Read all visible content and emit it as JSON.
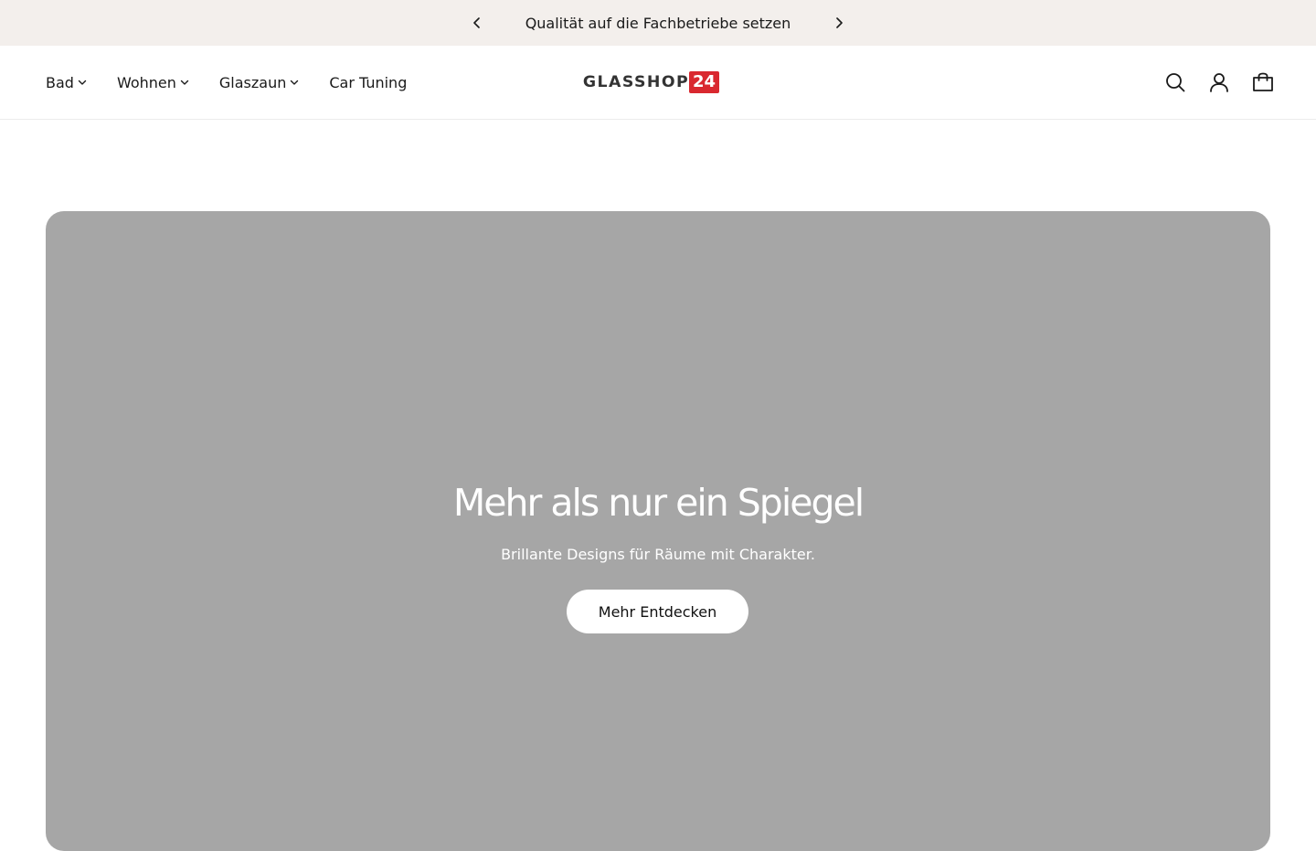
{
  "announcement": {
    "text": "Qualität auf die Fachbetriebe setzen",
    "prev_icon": "chevron-left-icon",
    "next_icon": "chevron-right-icon"
  },
  "header": {
    "nav": [
      {
        "label": "Bad",
        "has_dropdown": true
      },
      {
        "label": "Wohnen",
        "has_dropdown": true
      },
      {
        "label": "Glaszaun",
        "has_dropdown": true
      },
      {
        "label": "Car Tuning",
        "has_dropdown": false
      }
    ],
    "logo": {
      "text": "GLASSHOP",
      "badge": "24",
      "badge_color": "#d9282f"
    },
    "icons": [
      "search-icon",
      "account-icon",
      "cart-icon"
    ]
  },
  "hero": {
    "title": "Mehr als nur ein Spiegel",
    "subtitle": "Brillante Designs für Räume mit Charakter.",
    "button_label": "Mehr Entdecken",
    "background_color": "#a6a6a6"
  },
  "colors": {
    "announcement_bg": "#f3efec",
    "text": "#1a1a1a"
  }
}
